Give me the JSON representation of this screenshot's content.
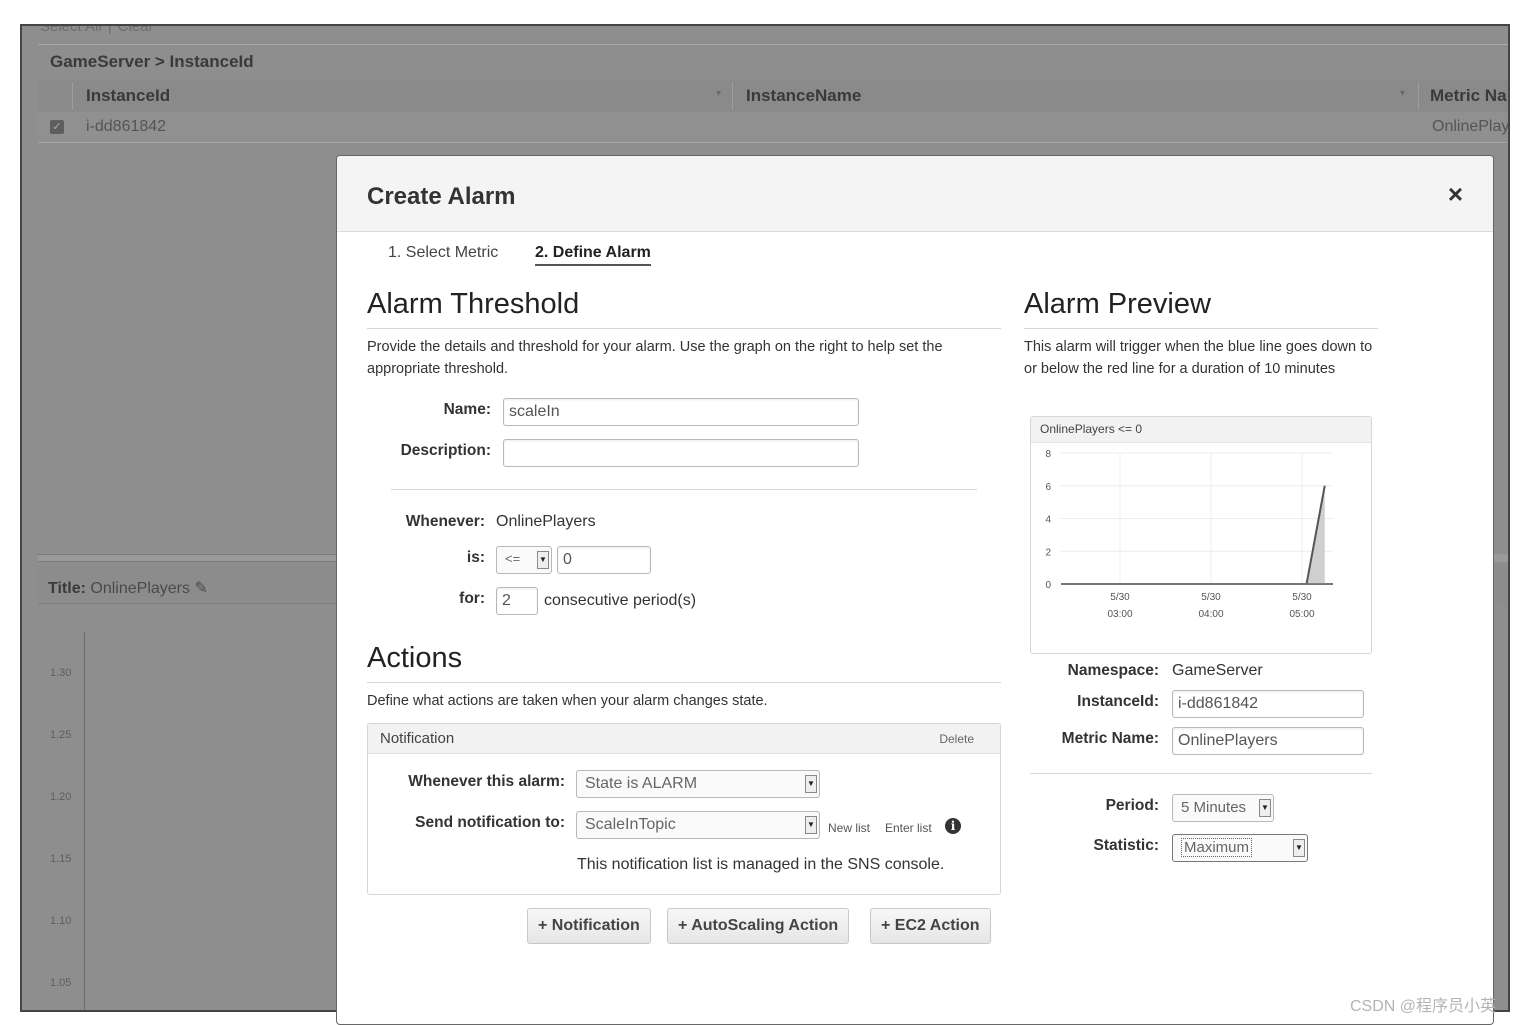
{
  "background": {
    "select_all": "Select All",
    "clear": "Clear",
    "breadcrumb": "GameServer > InstanceId",
    "columns": [
      "InstanceId",
      "InstanceName",
      "Metric Na"
    ],
    "row": {
      "instance_id": "i-dd861842",
      "metric_name": "OnlinePlay"
    },
    "graph_title_label": "Title:",
    "graph_title": "OnlinePlayers",
    "y_ticks": [
      "1.30",
      "1.25",
      "1.20",
      "1.15",
      "1.10",
      "1.05"
    ]
  },
  "modal": {
    "title": "Create Alarm",
    "close": "×",
    "steps": [
      "1. Select Metric",
      "2. Define Alarm"
    ],
    "threshold": {
      "heading": "Alarm Threshold",
      "description": "Provide the details and threshold for your alarm. Use the graph on the right to help set the appropriate threshold.",
      "name_label": "Name:",
      "name_value": "scaleIn",
      "description_label": "Description:",
      "description_value": "",
      "whenever_label": "Whenever:",
      "whenever_value": "OnlinePlayers",
      "is_label": "is:",
      "operator": "<=",
      "threshold_value": "0",
      "for_label": "for:",
      "periods_value": "2",
      "periods_suffix": "consecutive period(s)"
    },
    "actions": {
      "heading": "Actions",
      "description": "Define what actions are taken when your alarm changes state.",
      "notification": {
        "title": "Notification",
        "delete": "Delete",
        "whenever_label": "Whenever this alarm:",
        "state_value": "State is ALARM",
        "send_label": "Send notification to:",
        "topic_value": "ScaleInTopic",
        "new_list": "New list",
        "enter_list": "Enter list",
        "info_icon": "i",
        "note": "This notification list is managed in the SNS console."
      },
      "buttons": [
        "+ Notification",
        "+ AutoScaling Action",
        "+ EC2 Action"
      ]
    },
    "preview": {
      "heading": "Alarm Preview",
      "description": "This alarm will trigger when the blue line goes down to or below the red line for a duration of 10 minutes",
      "namespace_label": "Namespace:",
      "namespace_value": "GameServer",
      "instance_label": "InstanceId:",
      "instance_value": "i-dd861842",
      "metric_label": "Metric Name:",
      "metric_value": "OnlinePlayers",
      "period_label": "Period:",
      "period_value": "5 Minutes",
      "statistic_label": "Statistic:",
      "statistic_value": "Maximum"
    }
  },
  "chart_data": {
    "type": "line",
    "title": "OnlinePlayers <= 0",
    "x_ticks": [
      [
        "5/30",
        "03:00"
      ],
      [
        "5/30",
        "04:00"
      ],
      [
        "5/30",
        "05:00"
      ]
    ],
    "y_ticks": [
      "8",
      "6",
      "4",
      "2",
      "0"
    ],
    "ylim": [
      0,
      8
    ],
    "series": [
      {
        "x": [
          5.05,
          5.25
        ],
        "y": [
          0,
          6
        ]
      }
    ],
    "threshold": 0,
    "grid": true
  },
  "watermark": "CSDN @程序员小英"
}
